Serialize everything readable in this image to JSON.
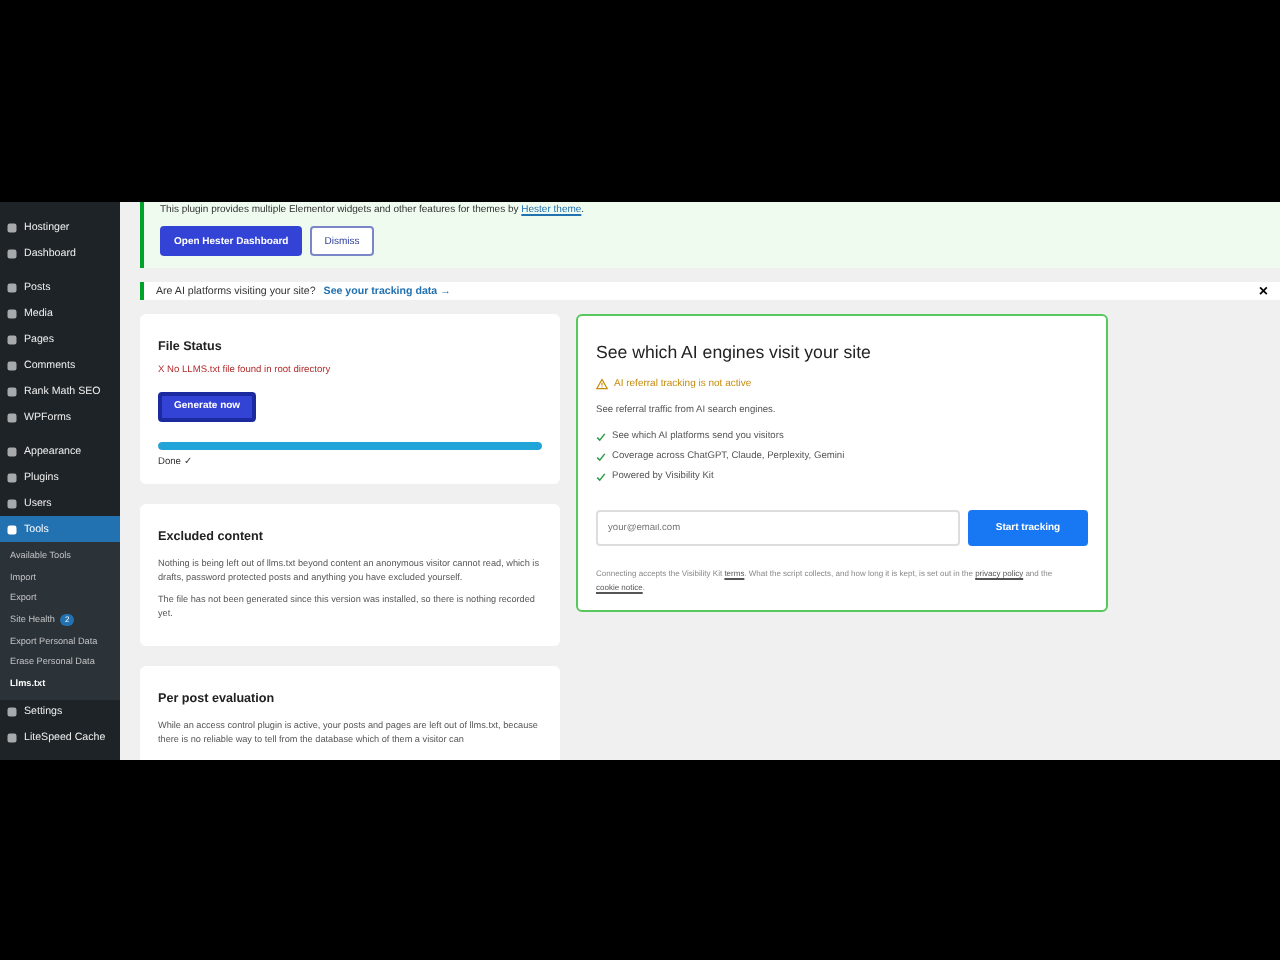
{
  "sidebar": {
    "items": [
      {
        "label": "Hostinger",
        "selected": false
      },
      {
        "label": "Dashboard",
        "selected": false
      },
      {
        "label": "Posts",
        "selected": false
      },
      {
        "label": "Media",
        "selected": false
      },
      {
        "label": "Pages",
        "selected": false
      },
      {
        "label": "Comments",
        "selected": false
      },
      {
        "label": "Rank Math SEO",
        "selected": false
      },
      {
        "label": "WPForms",
        "selected": false
      },
      {
        "label": "Appearance",
        "selected": false
      },
      {
        "label": "Plugins",
        "selected": false
      },
      {
        "label": "Users",
        "selected": false
      },
      {
        "label": "Tools",
        "selected": true,
        "children": [
          {
            "label": "Available Tools",
            "selected": false
          },
          {
            "label": "Import",
            "selected": false
          },
          {
            "label": "Export",
            "selected": false
          },
          {
            "label": "Site Health",
            "selected": false,
            "badge": "2"
          },
          {
            "label": "Export Personal Data",
            "selected": false
          },
          {
            "label": "Erase Personal Data",
            "selected": false
          },
          {
            "label": "Llms.txt",
            "selected": true
          }
        ]
      },
      {
        "label": "Settings",
        "selected": false
      },
      {
        "label": "LiteSpeed Cache",
        "selected": false
      }
    ]
  },
  "plugin_notice": {
    "text": "This plugin provides multiple Elementor widgets and other features for themes by",
    "link": "Hester theme",
    "end": ".",
    "buttons": [
      "Open Hester Dashboard",
      "Dismiss"
    ]
  },
  "ai_notice": {
    "text": "Are AI platforms visiting your site?",
    "link": "See your tracking data →",
    "close": "×"
  },
  "file_status": {
    "title": "File Status",
    "error": "X No LLMS.txt file found in root directory",
    "button": "Generate now",
    "level": 1,
    "status": "Done ✓"
  },
  "excluded": {
    "title": "Excluded content",
    "paragraphs": [
      "Nothing is being left out of llms.txt beyond content an anonymous visitor cannot read, which is drafts, password protected posts and anything you have excluded yourself.",
      "The file has not been generated since this version was installed, so there is nothing recorded yet."
    ]
  },
  "per_post": {
    "title": "Per post evaluation",
    "text": "While an access control plugin is active, your posts and pages are left out of llms.txt, because there is no reliable way to tell from the database which of them a visitor can"
  },
  "tracking": {
    "title": "See which AI engines visit your site",
    "warning": "AI referral tracking is not active",
    "intro": "See referral traffic from AI search engines.",
    "features": [
      "See which AI platforms send you visitors",
      "Coverage across ChatGPT, Claude, Perplexity, Gemini",
      "Powered by Visibility Kit"
    ],
    "email_placeholder": "your@email.com",
    "button": "Start tracking",
    "legal": [
      "Connecting accepts the Visibility Kit ",
      "terms",
      ". What the script collects, and how long it is kept, is set out in the ",
      "privacy policy",
      " and the ",
      "cookie notice",
      "."
    ]
  }
}
